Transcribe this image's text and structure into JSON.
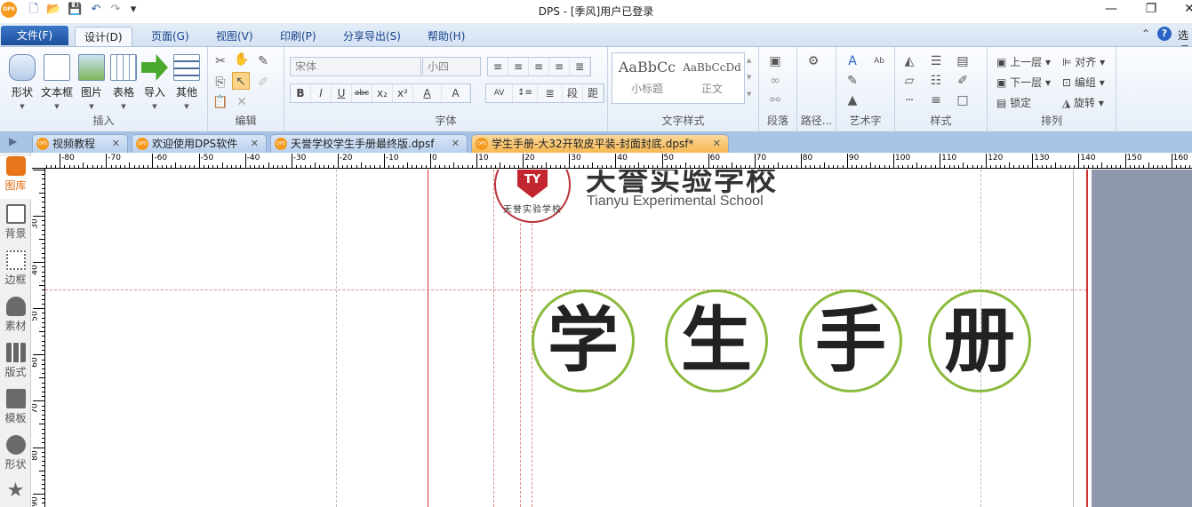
{
  "titlebar": {
    "title": "DPS - [季风]用户已登录",
    "logo": "DPS",
    "minimize": "—",
    "restore": "❐",
    "close": "✕",
    "qa": {
      "new": "🗋",
      "open": "📂",
      "save": "💾",
      "undo": "↶",
      "redo": "↷",
      "more": "▾"
    }
  },
  "menu": {
    "file": "文件(F)",
    "tabs": [
      "设计(D)",
      "页面(G)",
      "视图(V)",
      "印刷(P)",
      "分享导出(S)",
      "帮助(H)"
    ],
    "right_label": "选项",
    "help": "?",
    "collapse": "⌃"
  },
  "ribbon": {
    "insert": {
      "label": "插入",
      "items": [
        "形状",
        "文本框",
        "图片",
        "表格",
        "导入",
        "其他"
      ]
    },
    "edit": {
      "label": "编辑"
    },
    "font": {
      "label": "字体",
      "font_name": "宋体",
      "font_size": "小四",
      "format_buttons": [
        "B",
        "I",
        "U",
        "abc",
        "x₂",
        "x²",
        "A",
        "A"
      ],
      "align_buttons": [
        "≡",
        "≡",
        "≡",
        "≡",
        "≣"
      ],
      "para_buttons": [
        "AV",
        "↕≡",
        "≣",
        "段",
        "距"
      ]
    },
    "text_styles": {
      "label": "文字样式",
      "styles": [
        {
          "sample": "AaBbCc",
          "name": "小标题"
        },
        {
          "sample": "AaBbCcDd",
          "name": "正文"
        }
      ]
    },
    "paragraph": {
      "label": "段落"
    },
    "path": {
      "label": "路径..."
    },
    "wordart": {
      "label": "艺术字"
    },
    "style": {
      "label": "样式"
    },
    "arrange": {
      "label": "排列",
      "items": [
        "上一层",
        "对齐",
        "下一层",
        "编组",
        "锁定",
        "旋转"
      ]
    }
  },
  "doc_tabs": [
    {
      "label": "视频教程",
      "active": false
    },
    {
      "label": "欢迎使用DPS软件",
      "active": false
    },
    {
      "label": "天誉学校学生手册最终版.dpsf",
      "active": false
    },
    {
      "label": "学生手册-大32开软皮平装-封面封底.dpsf*",
      "active": true
    }
  ],
  "sidebar": [
    "图库",
    "背景",
    "边框",
    "素材",
    "版式",
    "模板",
    "形状",
    ""
  ],
  "hruler_labels": [
    "-80",
    "-70",
    "-60",
    "-50",
    "-40",
    "-30",
    "-20",
    "-10",
    "0",
    "10",
    "20",
    "30",
    "40",
    "50",
    "60",
    "70",
    "80",
    "90",
    "100",
    "110",
    "120",
    "130",
    "140",
    "150",
    "160"
  ],
  "vruler_labels": [
    "30",
    "40",
    "50",
    "60",
    "70",
    "80",
    "90"
  ],
  "page": {
    "school_cn": "天誉实验学校",
    "school_en": "Tianyu Experimental School",
    "seal_text": "天誉实验学校",
    "seal_letters": "TY",
    "title_chars": [
      "学",
      "生",
      "手",
      "册"
    ],
    "accent": "#8bba3c",
    "guide_color": "#d23030",
    "margin_color": "#8e97ae"
  }
}
